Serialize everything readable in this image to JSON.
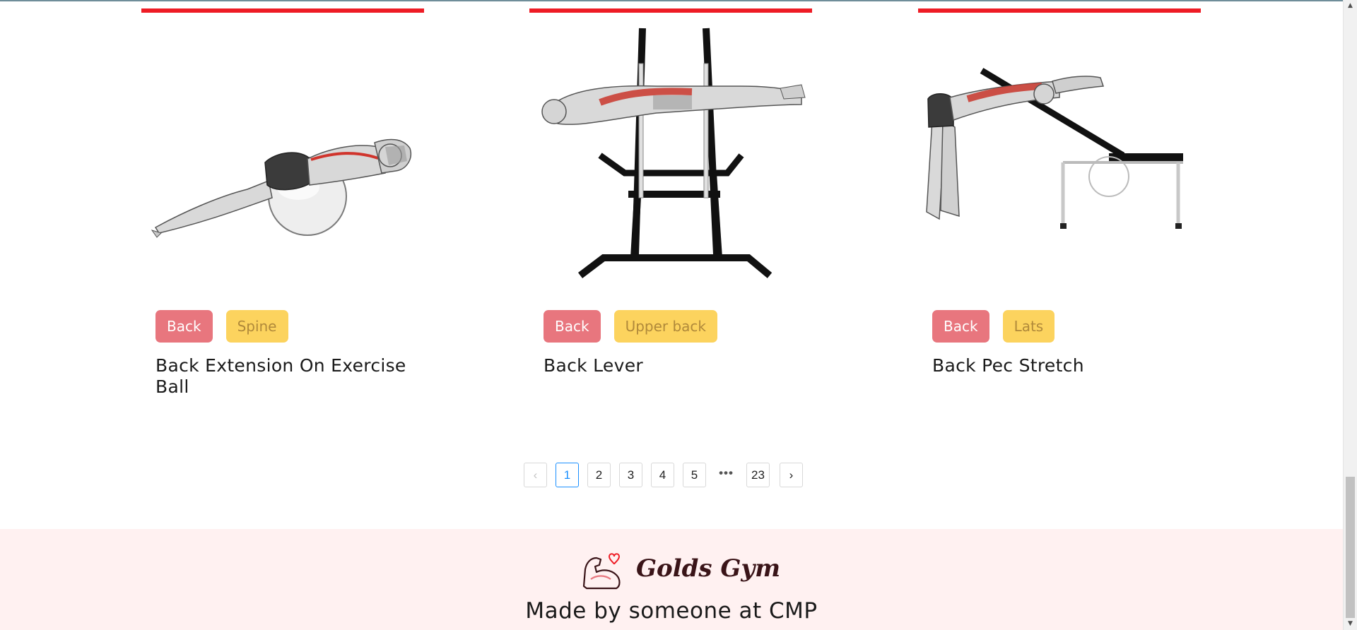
{
  "exercises": [
    {
      "name": "Back Extension On Exercise Ball",
      "body_part": "Back",
      "target": "Spine"
    },
    {
      "name": "Back Lever",
      "body_part": "Back",
      "target": "Upper back"
    },
    {
      "name": "Back Pec Stretch",
      "body_part": "Back",
      "target": "Lats"
    }
  ],
  "pagination": {
    "prev": "‹",
    "pages": [
      "1",
      "2",
      "3",
      "4",
      "5"
    ],
    "ellipsis": "•••",
    "last": "23",
    "next": "›",
    "current": "1"
  },
  "footer": {
    "brand": "Golds Gym",
    "credit": "Made by someone at CMP"
  },
  "colors": {
    "accent_bar": "#ee1c25",
    "tag_primary": "#e8767e",
    "tag_secondary": "#fcd35e",
    "active_page": "#1a8fff",
    "footer_bg": "#fff1f1"
  },
  "icons": {
    "logo": "flexed-arm-heart-icon",
    "scroll_up": "triangle-up-icon",
    "scroll_down": "triangle-down-icon"
  }
}
